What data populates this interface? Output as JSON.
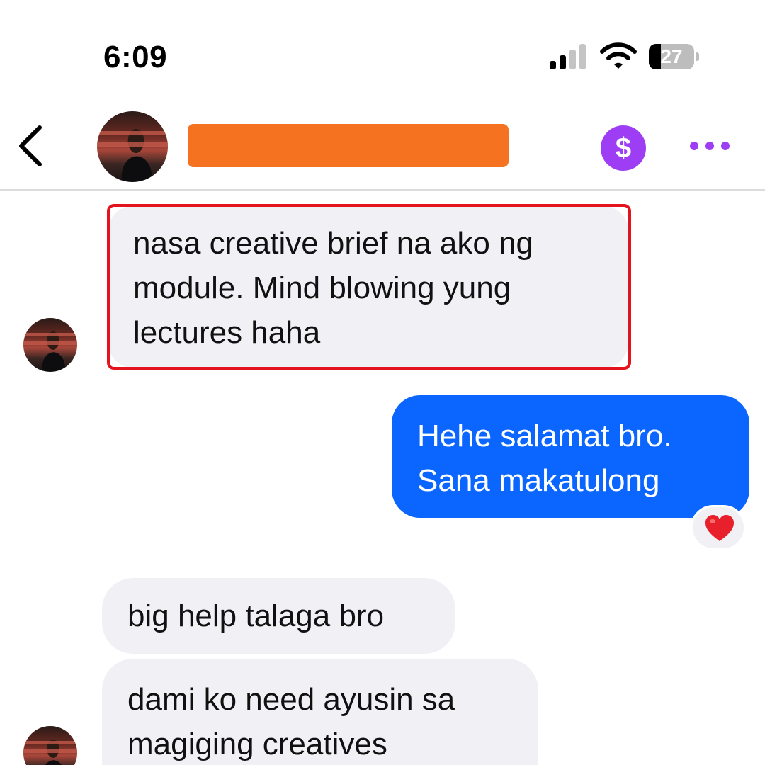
{
  "status_bar": {
    "time": "6:09",
    "battery_level": "27",
    "signal_bars_active": 2,
    "signal_bars_total": 4
  },
  "header": {
    "back_icon": "chevron-left-icon",
    "contact_name": "",
    "contact_name_redaction_color": "#f47220",
    "pay_icon": "dollar-sign-icon",
    "pay_symbol": "$",
    "more_icon": "more-dots-icon"
  },
  "colors": {
    "accent_purple": "#9d3ef5",
    "outgoing_bubble": "#0a66ff",
    "incoming_bubble": "#f1f1f5",
    "highlight_border": "#e4141f",
    "reaction_heart": "#e8202c"
  },
  "messages": [
    {
      "direction": "incoming",
      "text": "nasa creative brief na ako ng module. Mind blowing yung lectures haha",
      "highlighted": true
    },
    {
      "direction": "outgoing",
      "text": "Hehe salamat bro. Sana makatulong",
      "reaction": "heart"
    },
    {
      "direction": "incoming",
      "text": "big help talaga bro"
    },
    {
      "direction": "incoming",
      "text": "dami ko need ayusin sa magiging creatives"
    }
  ]
}
